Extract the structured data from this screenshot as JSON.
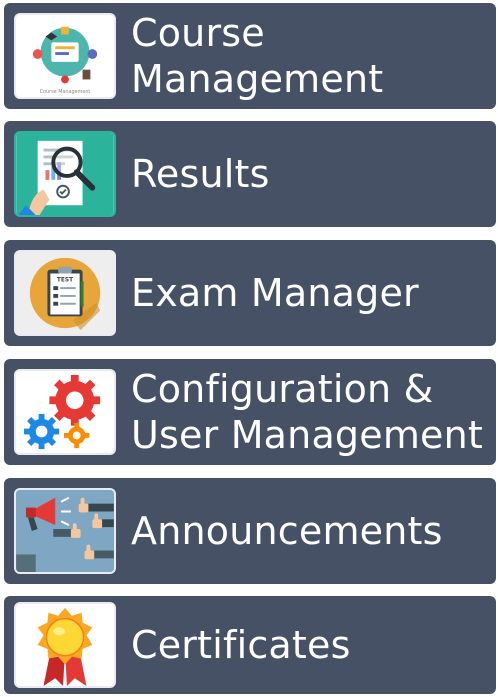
{
  "menu": {
    "items": [
      {
        "label_line1": "Course",
        "label_line2": "Management",
        "icon": "course-management-icon",
        "thumb_caption": "Course Management"
      },
      {
        "label_line1": "Results",
        "icon": "results-magnifier-icon"
      },
      {
        "label_line1": "Exam Manager",
        "icon": "exam-clipboard-icon",
        "thumb_caption": "TEST"
      },
      {
        "label_line1": "Configuration &",
        "label_line2": "User Management",
        "icon": "gears-icon"
      },
      {
        "label_line1": "Announcements",
        "icon": "megaphone-icon"
      },
      {
        "label_line1": "Certificates",
        "icon": "award-medal-icon"
      }
    ]
  },
  "colors": {
    "tile_bg": "#465166",
    "label_text": "#ffffff",
    "results_thumb_bg": "#2bb39b",
    "exam_thumb_circle": "#e8a53a",
    "announce_thumb_bg": "#7fa6c3"
  }
}
